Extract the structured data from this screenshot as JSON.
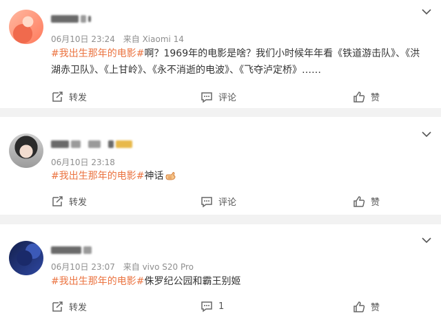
{
  "posts": [
    {
      "meta_date": "06月10日 23:24",
      "meta_source": "来自 Xiaomi 14",
      "tag": "#我出生那年的电影#",
      "body": "啊？1969年的电影是啥？我们小时候年年看《铁道游击队》、《洪湖赤卫队》、《上甘岭》、《永不消逝的电波》、《飞夺泸定桥》……",
      "repost_label": "转发",
      "comment_label": "评论",
      "like_label": "赞"
    },
    {
      "meta_date": "06月10日 23:18",
      "meta_source": "",
      "tag": "#我出生那年的电影#",
      "body": "神话",
      "repost_label": "转发",
      "comment_label": "评论",
      "like_label": "赞"
    },
    {
      "meta_date": "06月10日 23:07",
      "meta_source": "来自 vivo S20 Pro",
      "tag": "#我出生那年的电影#",
      "body": "侏罗纪公园和霸王别姬",
      "repost_label": "转发",
      "comment_label": "1",
      "like_label": "赞"
    }
  ],
  "icons": {
    "more": "chevron-down-icon",
    "repost": "repost-icon",
    "comment": "comment-icon",
    "like": "thumbs-up-icon",
    "emoji": "hand-emoji-icon"
  },
  "colors": {
    "tag": "#eb7340",
    "meta": "#8e8e8e",
    "background": "#f2f2f2"
  }
}
